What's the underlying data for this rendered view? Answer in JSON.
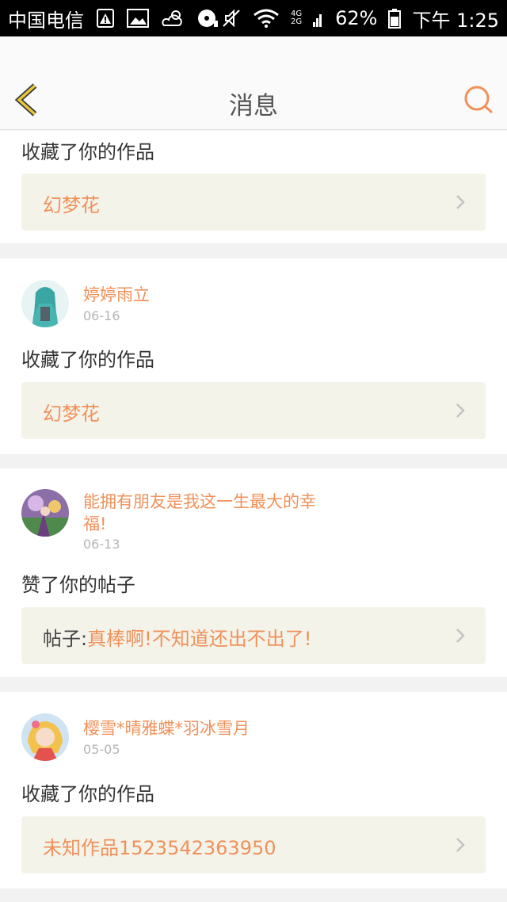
{
  "status_bar": {
    "carrier": "中国电信",
    "network_top": "4G",
    "network_bottom": "2G",
    "battery": "62%",
    "time": "下午 1:25"
  },
  "header": {
    "title": "消息",
    "back_icon": "chevron-left-icon",
    "search_icon": "search-icon"
  },
  "colors": {
    "accent": "#f0915a",
    "back_arrow": "#e6c63a",
    "link_box_bg": "#f4f3ea"
  },
  "feed": [
    {
      "action": "收藏了你的作品",
      "link": {
        "prefix": "",
        "text": "幻梦花"
      }
    },
    {
      "username": "婷婷雨立",
      "date": "06-16",
      "action": "收藏了你的作品",
      "link": {
        "prefix": "",
        "text": "幻梦花"
      }
    },
    {
      "username": "能拥有朋友是我这一生最大的幸福!",
      "date": "06-13",
      "action": "赞了你的帖子",
      "link": {
        "prefix": "帖子:",
        "text": "真棒啊!不知道还出不出了!"
      }
    },
    {
      "username": "樱雪*晴雅蝶*羽冰雪月",
      "date": "05-05",
      "action": "收藏了你的作品",
      "link": {
        "prefix": "",
        "text": "未知作品1523542363950"
      }
    }
  ]
}
